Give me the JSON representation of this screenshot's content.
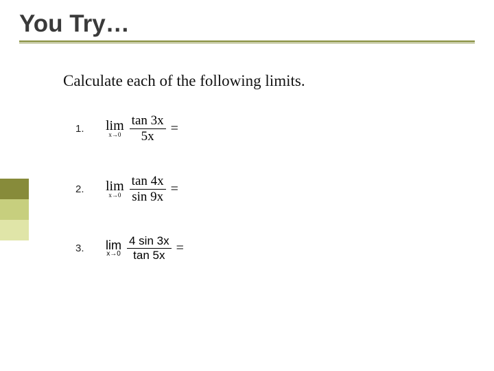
{
  "header": {
    "title": "You Try…"
  },
  "instruction": "Calculate each of the following limits.",
  "problems": [
    {
      "number": "1.",
      "lim_label": "lim",
      "lim_sub": "x→0",
      "numer": "tan 3x",
      "denom": "5x",
      "equals": "="
    },
    {
      "number": "2.",
      "lim_label": "lim",
      "lim_sub": "x→0",
      "numer": "tan 4x",
      "denom": "sin 9x",
      "equals": "="
    },
    {
      "number": "3.",
      "lim_label": "lim",
      "lim_sub_pre": "x→0",
      "numer": "4 sin 3x",
      "denom": "tan 5x",
      "equals": "="
    }
  ]
}
